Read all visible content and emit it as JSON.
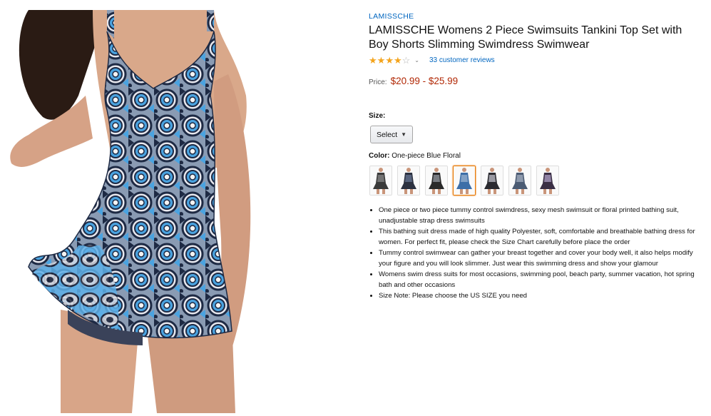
{
  "product": {
    "brand": "LAMISSCHE",
    "title": "LAMISSCHE Womens 2 Piece Swimsuits Tankini Top Set with Boy Shorts Slimming Swimdress Swimwear",
    "rating": 4.0,
    "reviews_text": "33 customer reviews",
    "price_label": "Price:",
    "price_value": "$20.99 - $25.99"
  },
  "size": {
    "label": "Size:",
    "selected": "Select"
  },
  "color": {
    "label": "Color:",
    "selected": "One-piece Blue Floral",
    "swatches": [
      {
        "name": "swatch-1",
        "main": "#3a3a3a",
        "accent": "#8c8c8c"
      },
      {
        "name": "swatch-2",
        "main": "#2c3140",
        "accent": "#6b7a99"
      },
      {
        "name": "swatch-3",
        "main": "#2a2a2a",
        "accent": "#9aa0a8"
      },
      {
        "name": "swatch-4",
        "main": "#3d6fa8",
        "accent": "#9fb6d1"
      },
      {
        "name": "swatch-5",
        "main": "#2a2a30",
        "accent": "#c9c9d3"
      },
      {
        "name": "swatch-6",
        "main": "#4b5b73",
        "accent": "#a9b4c4"
      },
      {
        "name": "swatch-7",
        "main": "#3b2f45",
        "accent": "#b7a6cf"
      }
    ],
    "selected_index": 3
  },
  "bullets": [
    "One piece or two piece tummy control swimdress, sexy mesh swimsuit or floral printed bathing suit, unadjustable strap dress swimsuits",
    "This bathing suit dress made of high quality Polyester, soft, comfortable and breathable bathing dress for women. For perfect fit, please check the Size Chart carefully before place the order",
    "Tummy control swimwear can gather your breast together and cover your body well, it also helps modify your figure and you will look slimmer. Just wear this swimming dress and show your glamour",
    "Womens swim dress suits for most occasions, swimming pool, beach party, summer vacation, hot spring bath and other occasions",
    "Size Note: Please choose the US SIZE you need"
  ],
  "colors": {
    "link": "#0066c0",
    "price": "#b12704",
    "star": "#f4a41c",
    "selected_border": "#e77600"
  },
  "icons": {
    "rating": "star-icon",
    "rating_dropdown": "chevron-down-icon",
    "select_caret": "caret-down-icon"
  }
}
